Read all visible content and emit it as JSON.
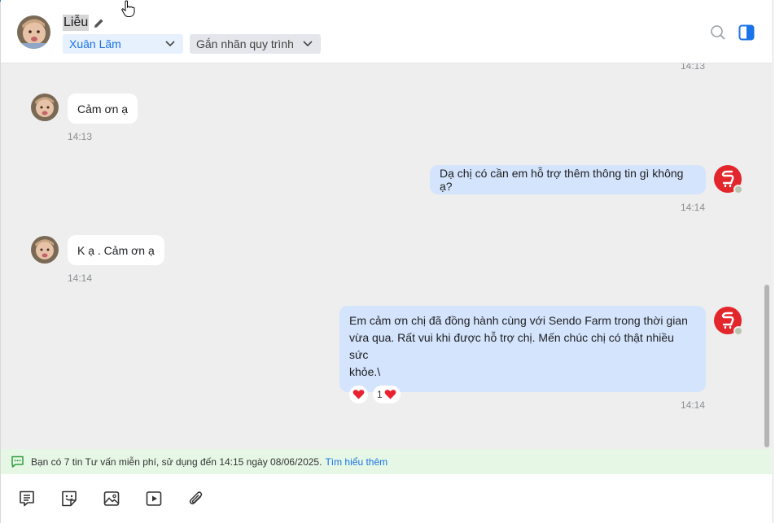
{
  "header": {
    "contact_name": "Liễu",
    "assignee": "Xuân Lãm",
    "tag_placeholder": "Gắn nhãn quy trình"
  },
  "messages": {
    "top_time": "14:13",
    "items": [
      {
        "direction": "in",
        "text": "Cảm ơn ạ",
        "time": "14:13"
      },
      {
        "direction": "out",
        "text": "Dạ chị có cần em hỗ trợ thêm thông tin gì không ạ?",
        "time": "14:14"
      },
      {
        "direction": "in",
        "text": "K ạ . Cảm ơn ạ",
        "time": "14:14"
      },
      {
        "direction": "out",
        "text_lines": [
          "Em cảm ơn chị đã đồng hành cùng với Sendo Farm trong thời gian",
          "vừa qua. Rất vui khi được hỗ trợ chị. Mến chúc chị có thật nhiều sức",
          "khỏe.\\"
        ],
        "time": "14:14",
        "reaction_count": "1"
      }
    ]
  },
  "notice": {
    "text": "Bạn có 7 tin Tư vấn miễn phí, sử dụng đến 14:15 ngày 08/06/2025.",
    "link": "Tìm hiểu thêm"
  },
  "toolbar": {
    "icons": [
      "template-icon",
      "sticker-icon",
      "image-icon",
      "video-icon",
      "attachment-icon"
    ]
  },
  "colors": {
    "accent": "#1a73e8",
    "bubble_out": "#d4e4fc",
    "bubble_in": "#ffffff",
    "chat_bg": "#eeeeee",
    "notice_bg": "#e6f7e5",
    "shop_red": "#e3262c",
    "reaction_heart": "#e8232f"
  }
}
